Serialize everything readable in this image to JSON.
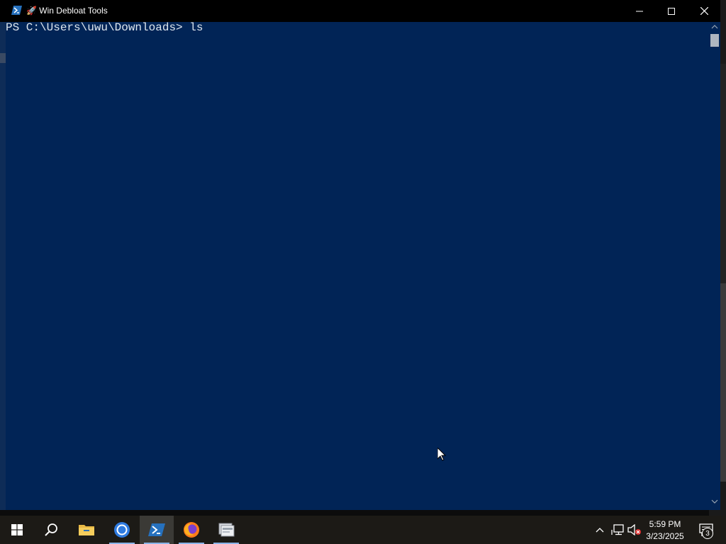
{
  "window": {
    "title": "🚀 Win Debloat Tools",
    "app_icon": "powershell-icon",
    "controls": [
      "minimize-icon",
      "maximize-icon",
      "close-icon"
    ]
  },
  "console": {
    "prompt": "PS C:\\Users\\uwu\\Downloads> ",
    "command": "ls",
    "background": "#012456",
    "foreground": "#dfe6ee"
  },
  "taskbar": {
    "items": [
      {
        "name": "start",
        "icon": "windows-logo-icon"
      },
      {
        "name": "search",
        "icon": "search-icon"
      },
      {
        "name": "file-explorer",
        "icon": "folder-icon"
      },
      {
        "name": "chrome",
        "icon": "chrome-icon"
      },
      {
        "name": "powershell",
        "icon": "powershell-icon",
        "active": true
      },
      {
        "name": "firefox",
        "icon": "firefox-icon"
      },
      {
        "name": "app",
        "icon": "app-window-icon"
      }
    ],
    "tray": {
      "icons": [
        "chevron-up-icon",
        "network-icon",
        "volume-muted-icon"
      ],
      "time": "5:59 PM",
      "date": "3/23/2025",
      "notification_count": "3"
    }
  }
}
